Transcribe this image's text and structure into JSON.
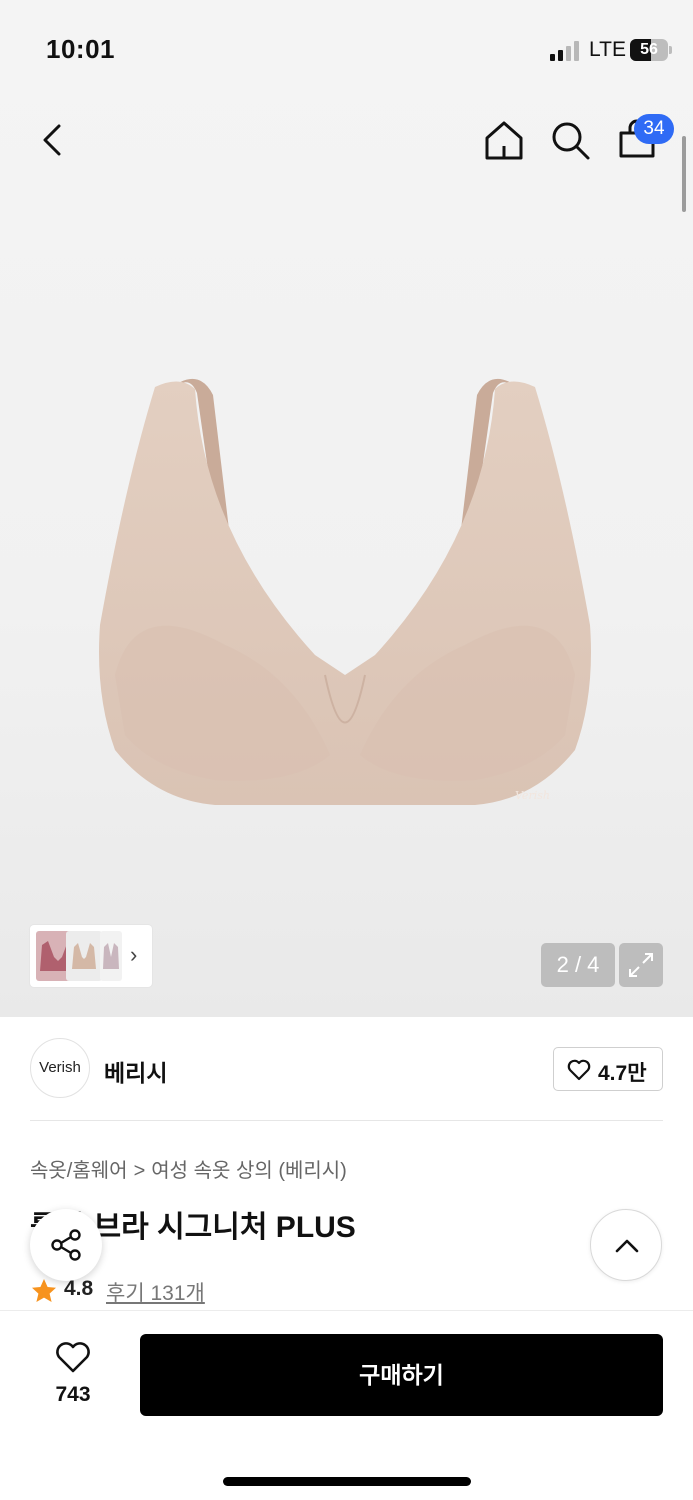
{
  "status_bar": {
    "time": "10:01",
    "network": "LTE",
    "battery": "56",
    "battery_level_percent": 56
  },
  "top_nav": {
    "back_icon": "chevron-left-icon",
    "home_icon": "home-icon",
    "search_icon": "search-icon",
    "cart_icon": "shopping-bag-icon",
    "cart_badge": "34",
    "badge_color": "#2f6bf5"
  },
  "gallery": {
    "page_indicator": "2 / 4",
    "thumbnail_next_icon": "chevron-right-icon",
    "expand_icon": "expand-icon"
  },
  "brand": {
    "logo_text": "Verish",
    "name": "베리시",
    "like_icon": "heart-icon",
    "like_count": "4.7만"
  },
  "breadcrumb": {
    "items": [
      "속옷/홈웨어",
      "여성 속옷 상의 (베리시)"
    ],
    "separator": ">"
  },
  "product": {
    "title": "룰라 브라 시그니처 PLUS",
    "rating": "4.8",
    "reviews": "후기 131개",
    "star_color": "#f7931e"
  },
  "floating": {
    "share_icon": "share-icon",
    "scroll_top_icon": "chevron-up-icon"
  },
  "bottom_bar": {
    "wish_icon": "heart-icon",
    "wish_count": "743",
    "buy_label": "구매하기"
  }
}
